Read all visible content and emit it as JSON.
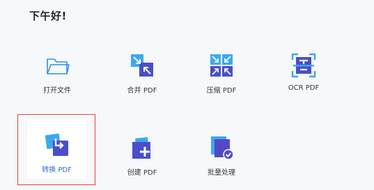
{
  "greeting": "下午好!",
  "tools": {
    "open_file": {
      "label": "打开文件",
      "icon": "folder-icon"
    },
    "merge_pdf": {
      "label": "合并 PDF",
      "icon": "merge-arrows-icon"
    },
    "compress_pdf": {
      "label": "压缩 PDF",
      "icon": "compress-arrows-icon"
    },
    "ocr_pdf": {
      "label": "OCR PDF",
      "icon": "ocr-scan-icon"
    },
    "convert_pdf": {
      "label": "转换 PDF",
      "icon": "convert-arrow-icon",
      "selected": true
    },
    "create_pdf": {
      "label": "创建 PDF",
      "icon": "create-plus-icon"
    },
    "batch_process": {
      "label": "批量处理",
      "icon": "batch-check-icon"
    }
  },
  "colors": {
    "accent": "#2e6be6",
    "selection_border": "#e0433c",
    "icon_blue": "#3f5fd8",
    "icon_light": "#48c3f0"
  }
}
